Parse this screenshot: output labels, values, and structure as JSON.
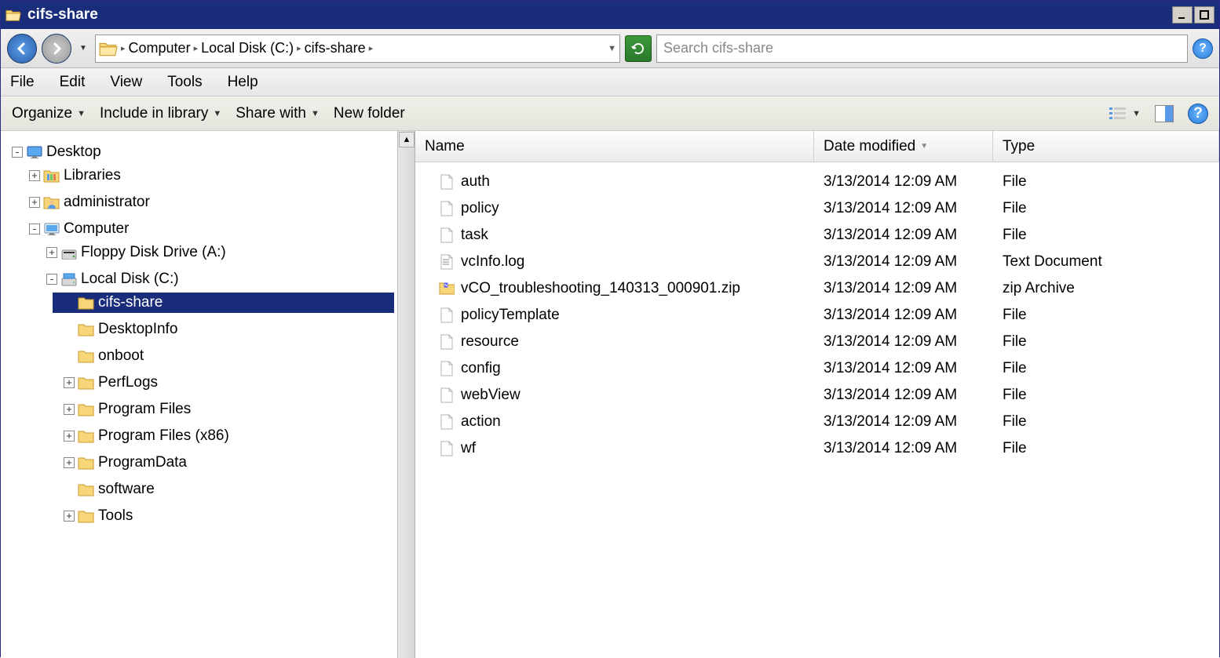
{
  "window": {
    "title": "cifs-share"
  },
  "breadcrumb": {
    "parts": [
      "Computer",
      "Local Disk (C:)",
      "cifs-share"
    ]
  },
  "search": {
    "placeholder": "Search cifs-share"
  },
  "menubar": {
    "file": "File",
    "edit": "Edit",
    "view": "View",
    "tools": "Tools",
    "help": "Help"
  },
  "toolbar": {
    "organize": "Organize",
    "include": "Include in library",
    "share": "Share with",
    "newfolder": "New folder"
  },
  "columns": {
    "name": "Name",
    "date": "Date modified",
    "type": "Type"
  },
  "tree": {
    "desktop": "Desktop",
    "libraries": "Libraries",
    "administrator": "administrator",
    "computer": "Computer",
    "floppy": "Floppy Disk Drive (A:)",
    "localdisk": "Local Disk (C:)",
    "cifsshare": "cifs-share",
    "desktopinfo": "DesktopInfo",
    "onboot": "onboot",
    "perflogs": "PerfLogs",
    "programfiles": "Program Files",
    "programfilesx86": "Program Files (x86)",
    "programdata": "ProgramData",
    "software": "software",
    "tools": "Tools"
  },
  "files": [
    {
      "name": "auth",
      "date": "3/13/2014 12:09 AM",
      "type": "File",
      "icon": "file"
    },
    {
      "name": "policy",
      "date": "3/13/2014 12:09 AM",
      "type": "File",
      "icon": "file"
    },
    {
      "name": "task",
      "date": "3/13/2014 12:09 AM",
      "type": "File",
      "icon": "file"
    },
    {
      "name": "vcInfo.log",
      "date": "3/13/2014 12:09 AM",
      "type": "Text Document",
      "icon": "txt"
    },
    {
      "name": "vCO_troubleshooting_140313_000901.zip",
      "date": "3/13/2014 12:09 AM",
      "type": "zip Archive",
      "icon": "zip"
    },
    {
      "name": "policyTemplate",
      "date": "3/13/2014 12:09 AM",
      "type": "File",
      "icon": "file"
    },
    {
      "name": "resource",
      "date": "3/13/2014 12:09 AM",
      "type": "File",
      "icon": "file"
    },
    {
      "name": "config",
      "date": "3/13/2014 12:09 AM",
      "type": "File",
      "icon": "file"
    },
    {
      "name": "webView",
      "date": "3/13/2014 12:09 AM",
      "type": "File",
      "icon": "file"
    },
    {
      "name": "action",
      "date": "3/13/2014 12:09 AM",
      "type": "File",
      "icon": "file"
    },
    {
      "name": "wf",
      "date": "3/13/2014 12:09 AM",
      "type": "File",
      "icon": "file"
    }
  ]
}
